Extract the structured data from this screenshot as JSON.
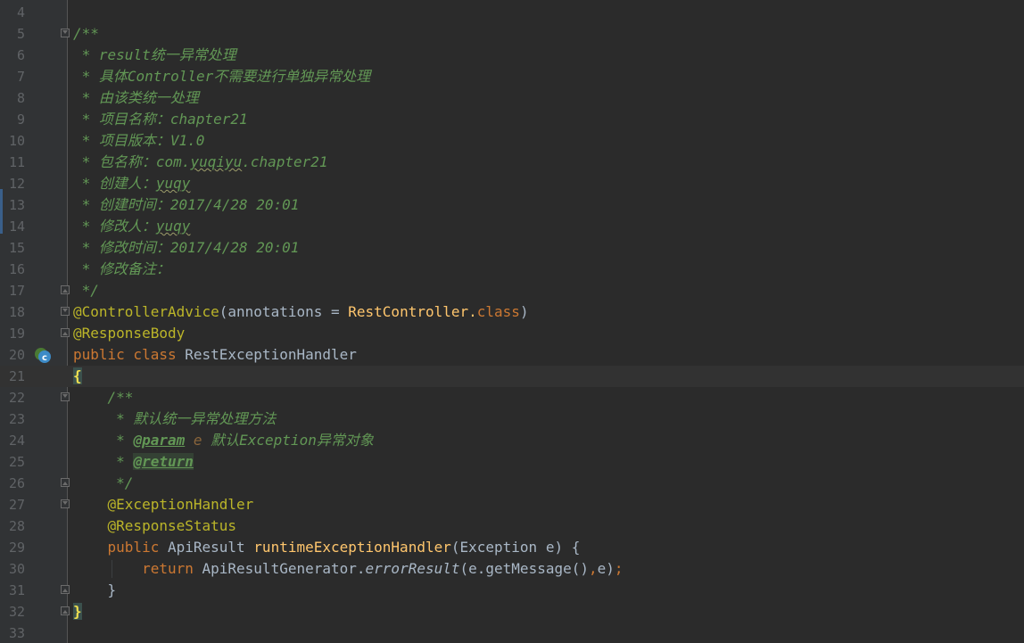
{
  "colors": {
    "background": "#2b2b2b",
    "gutter": "#313335",
    "line_number": "#606366",
    "doc_comment": "#629755",
    "annotation": "#bbb529",
    "keyword": "#cc7832",
    "identifier": "#a9b7c6",
    "method_decl": "#ffc66d",
    "brace_highlight": "#f0e050"
  },
  "lines": [
    {
      "num": "4"
    },
    {
      "num": "5",
      "c1": "/**"
    },
    {
      "num": "6",
      "c1": " * result统一异常处理"
    },
    {
      "num": "7",
      "c1": " * 具体Controller不需要进行单独异常处理"
    },
    {
      "num": "8",
      "c1": " * 由该类统一处理"
    },
    {
      "num": "9",
      "c1": " * 项目名称：chapter21"
    },
    {
      "num": "10",
      "c1": " * 项目版本：V1.0"
    },
    {
      "num": "11",
      "c1": " * 包名称：com.",
      "c2": "yuqiyu",
      "c3": ".chapter21"
    },
    {
      "num": "12",
      "c1": " * 创建人：",
      "c2": "yuqy"
    },
    {
      "num": "13",
      "c1": " * 创建时间：2017/4/28 20:01"
    },
    {
      "num": "14",
      "c1": " * 修改人：",
      "c2": "yuqy"
    },
    {
      "num": "15",
      "c1": " * 修改时间：2017/4/28 20:01"
    },
    {
      "num": "16",
      "c1": " * 修改备注："
    },
    {
      "num": "17",
      "c1": " */"
    },
    {
      "num": "18",
      "c1": "@ControllerAdvice",
      "c2": "(annotations = ",
      "c3": "RestController.",
      "c4": "class",
      "c5": ")"
    },
    {
      "num": "19",
      "c1": "@ResponseBody"
    },
    {
      "num": "20",
      "c1": "public class ",
      "c2": "RestExceptionHandler"
    },
    {
      "num": "21",
      "c1": "{"
    },
    {
      "num": "22",
      "c1": "    /**"
    },
    {
      "num": "23",
      "c1": "     * 默认统一异常处理方法"
    },
    {
      "num": "24",
      "c1": "     * ",
      "c2": "@param",
      "c3": " e",
      "c4": " 默认Exception异常对象"
    },
    {
      "num": "25",
      "c1": "     * ",
      "c2": "@return"
    },
    {
      "num": "26",
      "c1": "     */"
    },
    {
      "num": "27",
      "c1": "    @ExceptionHandler"
    },
    {
      "num": "28",
      "c1": "    @ResponseStatus"
    },
    {
      "num": "29",
      "c1": "    public ",
      "c2": "ApiResult ",
      "c3": "runtimeExceptionHandler",
      "c4": "(Exception e) {"
    },
    {
      "num": "30",
      "c1": "        return ",
      "c2": "ApiResultGenerator.",
      "c3": "errorResult",
      "c4": "(e.getMessage()",
      "c5": ",",
      "c6": "e)",
      "c7": ";"
    },
    {
      "num": "31",
      "c1": "    }"
    },
    {
      "num": "32",
      "c1": "}"
    },
    {
      "num": "33"
    }
  ],
  "gutter_icon": "class-implementation-icon"
}
